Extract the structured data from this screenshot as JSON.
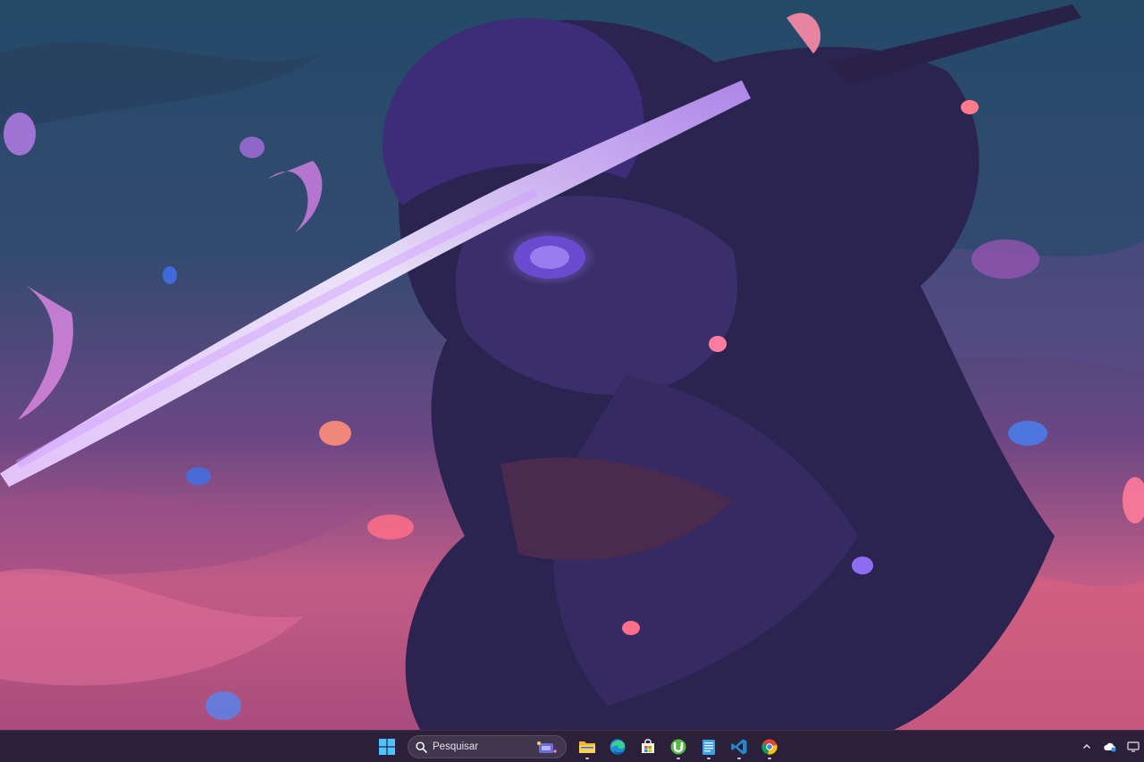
{
  "wallpaper": {
    "description_colors": [
      "#25496a",
      "#4a4378",
      "#c45f84",
      "#7a3fd0",
      "#e27ab8"
    ]
  },
  "taskbar": {
    "search": {
      "placeholder": "Pesquisar"
    },
    "apps": [
      {
        "name": "start",
        "icon": "windows-logo-icon"
      },
      {
        "name": "file-explorer",
        "icon": "folder-icon"
      },
      {
        "name": "edge",
        "icon": "edge-browser-icon"
      },
      {
        "name": "microsoft-store",
        "icon": "store-icon"
      },
      {
        "name": "utorrent",
        "icon": "utorrent-icon"
      },
      {
        "name": "notepad",
        "icon": "notepad-icon"
      },
      {
        "name": "vscode",
        "icon": "vscode-icon"
      },
      {
        "name": "chrome",
        "icon": "chrome-icon"
      }
    ],
    "tray": [
      "chevron-up-icon",
      "onedrive-icon",
      "show-desktop-icon"
    ]
  }
}
